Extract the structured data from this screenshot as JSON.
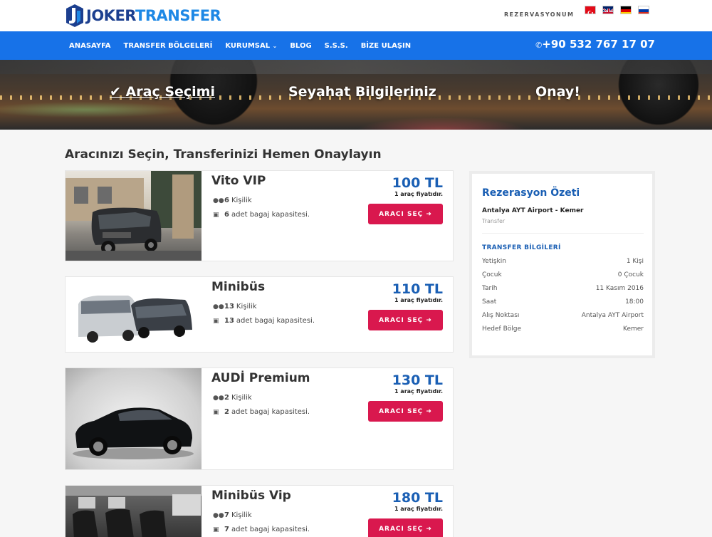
{
  "brand": {
    "part1": "JOKER",
    "part2": "TRANSFER",
    "accent": "#1e88e5",
    "dark": "#1c3f8f"
  },
  "header": {
    "reservation_link": "REZERVASYONUM",
    "flags": [
      "flag-turkey-icon",
      "flag-uk-icon",
      "flag-germany-icon",
      "flag-russia-icon"
    ]
  },
  "nav": {
    "items": [
      "ANASAYFA",
      "TRANSFER BÖLGELERİ",
      "KURUMSAL",
      "BLOG",
      "S.S.S.",
      "BİZE ULAŞIN"
    ],
    "phone": "+90 532 767 17 07",
    "bar_color": "#1772e8"
  },
  "steps": [
    "Araç Seçimi",
    "Seyahat Bilgileriniz",
    "Onay!"
  ],
  "main": {
    "title": "Aracınızı Seçin, Transferinizi Hemen Onaylayın"
  },
  "cars": [
    {
      "name": "Vito VIP",
      "persons": "6",
      "persons_label": "Kişilik",
      "luggage": "6",
      "luggage_label": "adet bagaj kapasitesi.",
      "price": "100 TL",
      "price_note": "1 araç fiyatıdır.",
      "button": "ARACI SEÇ"
    },
    {
      "name": "Minibüs",
      "persons": "13",
      "persons_label": "Kişilik",
      "luggage": "13",
      "luggage_label": "adet bagaj kapasitesi.",
      "price": "110 TL",
      "price_note": "1 araç fiyatıdır.",
      "button": "ARACI SEÇ"
    },
    {
      "name": "AUDİ Premium",
      "persons": "2",
      "persons_label": "Kişilik",
      "luggage": "2",
      "luggage_label": "adet bagaj kapasitesi.",
      "price": "130 TL",
      "price_note": "1 araç fiyatıdır.",
      "button": "ARACI SEÇ"
    },
    {
      "name": "Minibüs Vip",
      "persons": "7",
      "persons_label": "Kişilik",
      "luggage": "7",
      "luggage_label": "adet bagaj kapasitesi.",
      "price": "180 TL",
      "price_note": "1 araç fiyatıdır.",
      "button": "ARACI SEÇ"
    }
  ],
  "summary": {
    "title": "Rezerasyon Özeti",
    "route": "Antalya AYT Airport - Kemer",
    "type": "Transfer",
    "subtitle": "TRANSFER BİLGİLERİ",
    "rows": [
      {
        "label": "Yetişkin",
        "value": "1 Kişi"
      },
      {
        "label": "Çocuk",
        "value": "0 Çocuk"
      },
      {
        "label": "Tarih",
        "value": "11 Kasım 2016"
      },
      {
        "label": "Saat",
        "value": "18:00"
      },
      {
        "label": "Alış Noktası",
        "value": "Antalya AYT Airport"
      },
      {
        "label": "Hedef Bölge",
        "value": "Kemer"
      }
    ]
  },
  "colors": {
    "button": "#d9184e",
    "price": "#1a5fb4"
  }
}
